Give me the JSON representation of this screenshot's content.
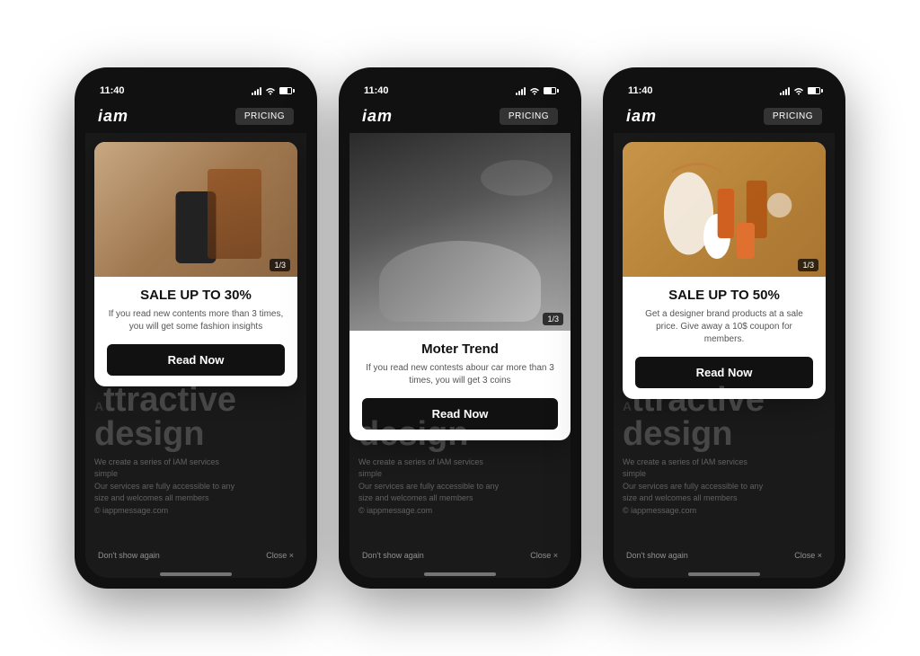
{
  "scene": {
    "background": "#ffffff"
  },
  "phones": [
    {
      "id": "phone-1",
      "status_time": "11:40",
      "logo": "iam",
      "pricing_label": "PRICING",
      "popup": {
        "image_type": "fashion",
        "badge": "1/3",
        "title": "SALE UP TO 30%",
        "description": "If you read new contents more than 3 times, you will get some fashion insights",
        "button_label": "Read Now"
      },
      "bg_text_large": "design",
      "bg_text_line1": "We create a series of IAM services",
      "bg_text_line2": "simple",
      "bg_text_line3": "Our services are fully accessible to any",
      "bg_text_line4": "size and welcomes all members",
      "bg_text_site": "© iappmessage.com",
      "dont_show": "Don't show again",
      "close": "Close ×"
    },
    {
      "id": "phone-2",
      "status_time": "11:40",
      "logo": "iam",
      "pricing_label": "PRICING",
      "popup": {
        "image_type": "car",
        "badge": "1/3",
        "title": "Moter Trend",
        "description": "If you read new contests abour car more than 3 times,  you will get 3 coins",
        "button_label": "Read Now"
      },
      "bg_text_large": "design",
      "bg_text_line1": "We create a series of IAM services",
      "bg_text_line2": "simple",
      "bg_text_line3": "Our services are fully accessible to any",
      "bg_text_line4": "size and welcomes all members",
      "bg_text_site": "© iappmessage.com",
      "dont_show": "Don't show again",
      "close": "Close ×"
    },
    {
      "id": "phone-3",
      "status_time": "11:40",
      "logo": "iam",
      "pricing_label": "PRICING",
      "popup": {
        "image_type": "products",
        "badge": "1/3",
        "title": "SALE UP TO 50%",
        "description": "Get a designer brand products at a sale price. Give away a 10$ coupon for members.",
        "button_label": "Read Now"
      },
      "bg_text_large": "design",
      "bg_text_line1": "We create a series of IAM services",
      "bg_text_line2": "simple",
      "bg_text_line3": "Our services are fully accessible to any",
      "bg_text_line4": "size and welcomes all members",
      "bg_text_site": "© iappmessage.com",
      "dont_show": "Don't show again",
      "close": "Close ×"
    }
  ]
}
